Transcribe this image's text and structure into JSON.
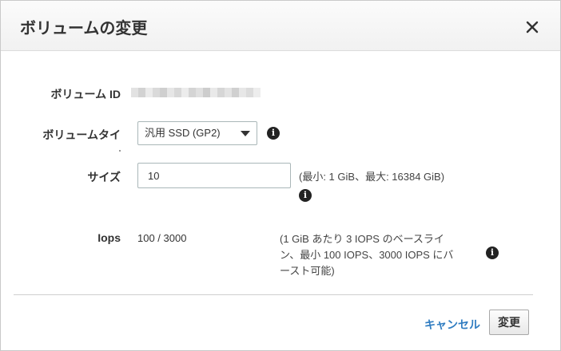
{
  "dialog": {
    "title": "ボリュームの変更",
    "close_icon": "close-icon"
  },
  "fields": {
    "volume_id": {
      "label": "ボリューム ID"
    },
    "volume_type": {
      "label": "ボリュームタイ",
      "selected": "汎用 SSD (GP2)"
    },
    "size": {
      "label": "サイズ",
      "value": "10",
      "hint": "(最小: 1 GiB、最大: 16384 GiB)"
    },
    "iops": {
      "label": "Iops",
      "value": "100 / 3000",
      "hint_line1": "(1 GiB あたり 3 IOPS のベースライ",
      "hint_line2": "ン、最小 100 IOPS、3000 IOPS にバ",
      "hint_line3": "ースト可能)"
    }
  },
  "footer": {
    "cancel_label": "キャンセル",
    "submit_label": "変更"
  },
  "colors": {
    "link": "#2f7cc1",
    "info_icon": "#222222"
  }
}
